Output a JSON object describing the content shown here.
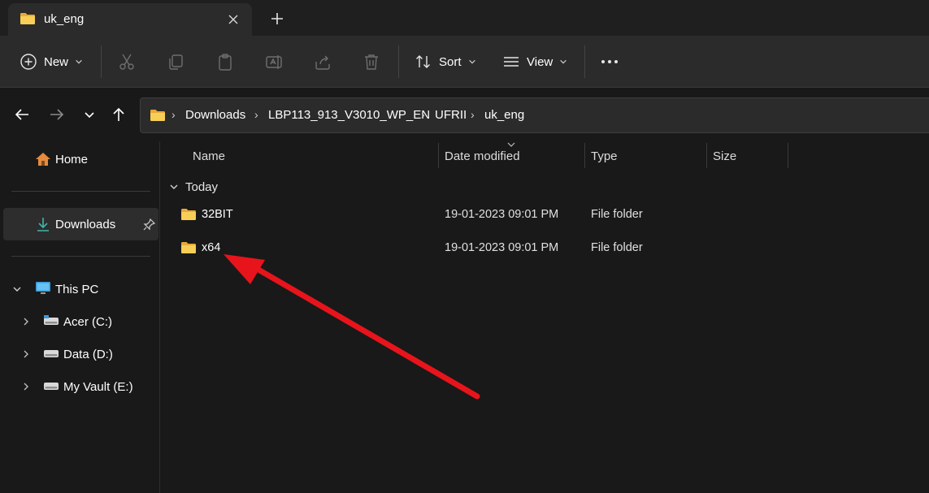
{
  "tab": {
    "title": "uk_eng",
    "close_icon": "close-icon",
    "new_tab_icon": "plus-icon"
  },
  "toolbar": {
    "new_label": "New",
    "sort_label": "Sort",
    "view_label": "View",
    "icons": [
      "cut-icon",
      "copy-icon",
      "paste-icon",
      "rename-icon",
      "share-icon",
      "delete-icon",
      "more-icon"
    ]
  },
  "address": {
    "crumbs": [
      "Downloads",
      "LBP113_913_V3010_WP_EN",
      "UFRII",
      "uk_eng"
    ]
  },
  "sidebar": {
    "home": "Home",
    "downloads": "Downloads",
    "this_pc": "This PC",
    "drives": [
      "Acer (C:)",
      "Data (D:)",
      "My Vault (E:)"
    ]
  },
  "columns": {
    "name": "Name",
    "date": "Date modified",
    "type": "Type",
    "size": "Size"
  },
  "group": {
    "label": "Today"
  },
  "files": [
    {
      "name": "32BIT",
      "date": "19-01-2023 09:01 PM",
      "type": "File folder"
    },
    {
      "name": "x64",
      "date": "19-01-2023 09:01 PM",
      "type": "File folder"
    }
  ],
  "colors": {
    "accent_folder": "#f4c542",
    "annotation_arrow": "#e8141b",
    "background": "#191919",
    "toolbar": "#2b2b2b"
  }
}
